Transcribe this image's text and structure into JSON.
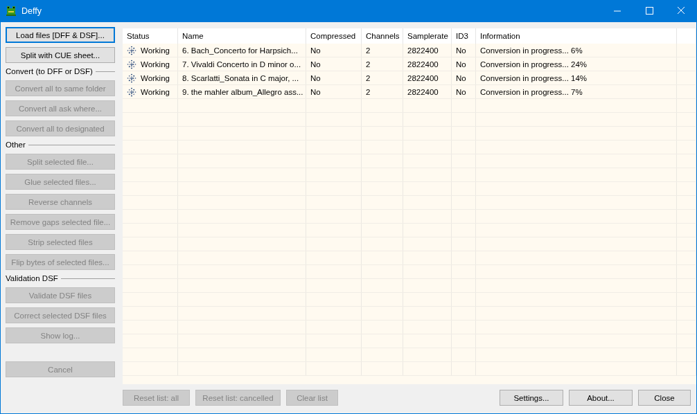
{
  "window": {
    "title": "Deffy"
  },
  "sidebar": [
    {
      "kind": "button",
      "label": "Load files [DFF & DSF]...",
      "disabled": false,
      "focused": true
    },
    {
      "kind": "button",
      "label": "Split with CUE sheet...",
      "disabled": false,
      "focused": false
    },
    {
      "kind": "section",
      "label": "Convert (to DFF or DSF)"
    },
    {
      "kind": "button",
      "label": "Convert all to same folder",
      "disabled": true,
      "focused": false
    },
    {
      "kind": "button",
      "label": "Convert all ask where...",
      "disabled": true,
      "focused": false
    },
    {
      "kind": "button",
      "label": "Convert all to designated",
      "disabled": true,
      "focused": false
    },
    {
      "kind": "section",
      "label": "Other"
    },
    {
      "kind": "button",
      "label": "Split selected file...",
      "disabled": true,
      "focused": false
    },
    {
      "kind": "button",
      "label": "Glue selected files...",
      "disabled": true,
      "focused": false
    },
    {
      "kind": "button",
      "label": "Reverse channels",
      "disabled": true,
      "focused": false
    },
    {
      "kind": "button",
      "label": "Remove gaps selected file...",
      "disabled": true,
      "focused": false
    },
    {
      "kind": "button",
      "label": "Strip selected files",
      "disabled": true,
      "focused": false
    },
    {
      "kind": "button",
      "label": "Flip bytes of selected files...",
      "disabled": true,
      "focused": false
    },
    {
      "kind": "section",
      "label": "Validation DSF"
    },
    {
      "kind": "button",
      "label": "Validate DSF files",
      "disabled": true,
      "focused": false
    },
    {
      "kind": "button",
      "label": "Correct selected DSF files",
      "disabled": true,
      "focused": false
    },
    {
      "kind": "button",
      "label": "Show log...",
      "disabled": true,
      "focused": false
    },
    {
      "kind": "spacer"
    },
    {
      "kind": "button",
      "label": "Cancel",
      "disabled": true,
      "focused": false
    }
  ],
  "table": {
    "columns": [
      "Status",
      "Name",
      "Compressed",
      "Channels",
      "Samplerate",
      "ID3",
      "Information"
    ],
    "rows": [
      {
        "status": "Working",
        "name": "6. Bach_Concerto for Harpsich...",
        "compressed": "No",
        "channels": "2",
        "samplerate": "2822400",
        "id3": "No",
        "information": "Conversion in progress... 6%"
      },
      {
        "status": "Working",
        "name": "7. Vivaldi Concerto in D minor o...",
        "compressed": "No",
        "channels": "2",
        "samplerate": "2822400",
        "id3": "No",
        "information": "Conversion in progress... 24%"
      },
      {
        "status": "Working",
        "name": "8. Scarlatti_Sonata in C major, ...",
        "compressed": "No",
        "channels": "2",
        "samplerate": "2822400",
        "id3": "No",
        "information": "Conversion in progress... 14%"
      },
      {
        "status": "Working",
        "name": "9. the mahler album_Allegro ass...",
        "compressed": "No",
        "channels": "2",
        "samplerate": "2822400",
        "id3": "No",
        "information": "Conversion in progress... 7%"
      }
    ]
  },
  "bottom_left_buttons": [
    {
      "label": "Reset list: all",
      "disabled": true
    },
    {
      "label": "Reset list: cancelled",
      "disabled": true
    },
    {
      "label": "Clear list",
      "disabled": true
    }
  ],
  "bottom_right_buttons": [
    {
      "label": "Settings...",
      "disabled": false
    },
    {
      "label": "About...",
      "disabled": false
    },
    {
      "label": "Close",
      "disabled": false
    }
  ]
}
